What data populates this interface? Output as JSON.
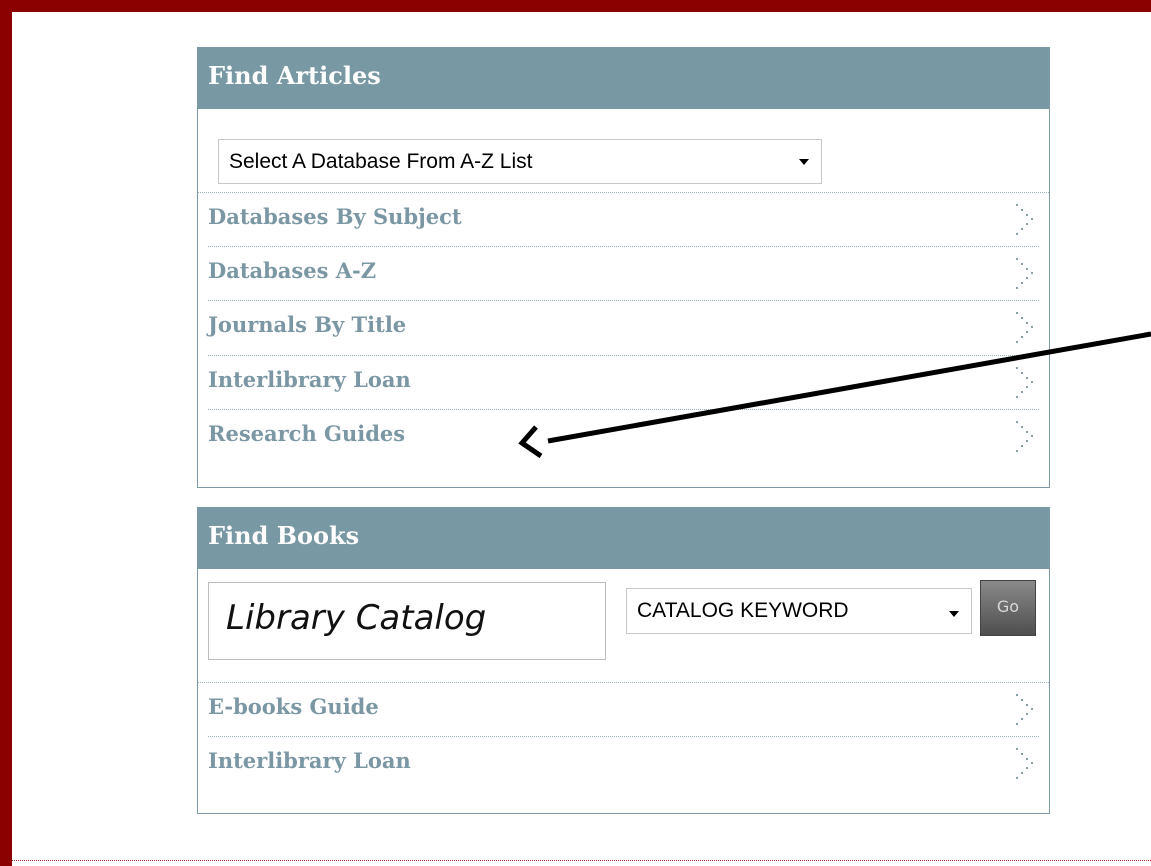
{
  "find_articles": {
    "title": "Find Articles",
    "database_select": {
      "value": "Select A Database From A-Z List"
    },
    "links": [
      {
        "label": "Databases By Subject"
      },
      {
        "label": "Databases A-Z"
      },
      {
        "label": "Journals By Title"
      },
      {
        "label": "Interlibrary Loan"
      },
      {
        "label": "Research Guides"
      }
    ]
  },
  "find_books": {
    "title": "Find Books",
    "catalog_label": "Library Catalog",
    "search_type_select": {
      "value": "CATALOG KEYWORD"
    },
    "go_label": "Go",
    "links": [
      {
        "label": "E-books Guide"
      },
      {
        "label": "Interlibrary Loan"
      }
    ]
  },
  "colors": {
    "frame": "#8b0000",
    "panel_header": "#7898a3",
    "link_text": "#7a97a3"
  },
  "icons": {
    "row_chevron": "chevron-right-icon",
    "dropdown": "chevron-down-icon"
  }
}
